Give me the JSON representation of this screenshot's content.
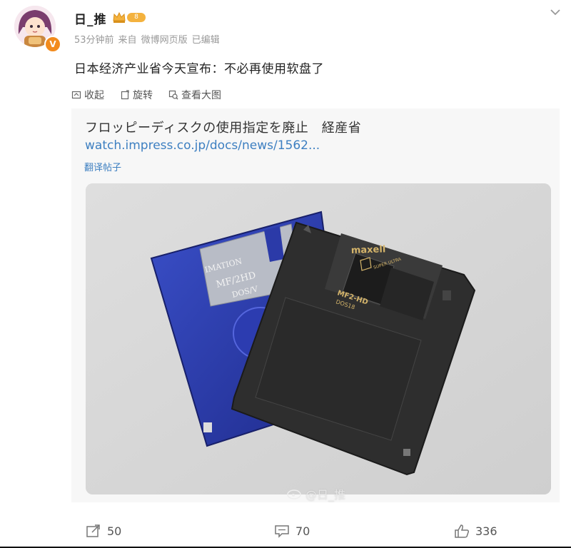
{
  "author": {
    "name": "日_推",
    "level": "8",
    "verified_badge": "V"
  },
  "post": {
    "time": "53分钟前",
    "source_label": "来自",
    "source": "微博网页版",
    "edited": "已编辑",
    "text": "日本经济产业省今天宣布：不必再使用软盘了"
  },
  "actions": {
    "collapse": "收起",
    "rotate": "旋转",
    "view_large": "查看大图"
  },
  "card": {
    "title": "フロッピーディスクの使用指定を廃止　経産省",
    "link": "watch.impress.co.jp/docs/news/1562...",
    "translate": "翻译帖子"
  },
  "photo": {
    "disk1_label_brand": "IMATION",
    "disk1_label_type": "MF/2HD",
    "disk1_label_format": "DOS/V",
    "disk2_brand": "maxell",
    "disk2_seal": "SUPER ULTRA",
    "disk2_type": "MF2-HD",
    "disk2_format": "DOS18"
  },
  "watermark": "@日_推",
  "footer": {
    "reposts": "50",
    "comments": "70",
    "likes": "336"
  },
  "colors": {
    "link": "#3d7fc1",
    "badge": "#f28b1d",
    "level": "#f4b23e"
  },
  "icons": [
    "chevron-down-icon",
    "collapse-icon",
    "rotate-icon",
    "zoom-icon",
    "repost-icon",
    "comment-icon",
    "like-icon",
    "crown-icon",
    "weibo-icon"
  ]
}
